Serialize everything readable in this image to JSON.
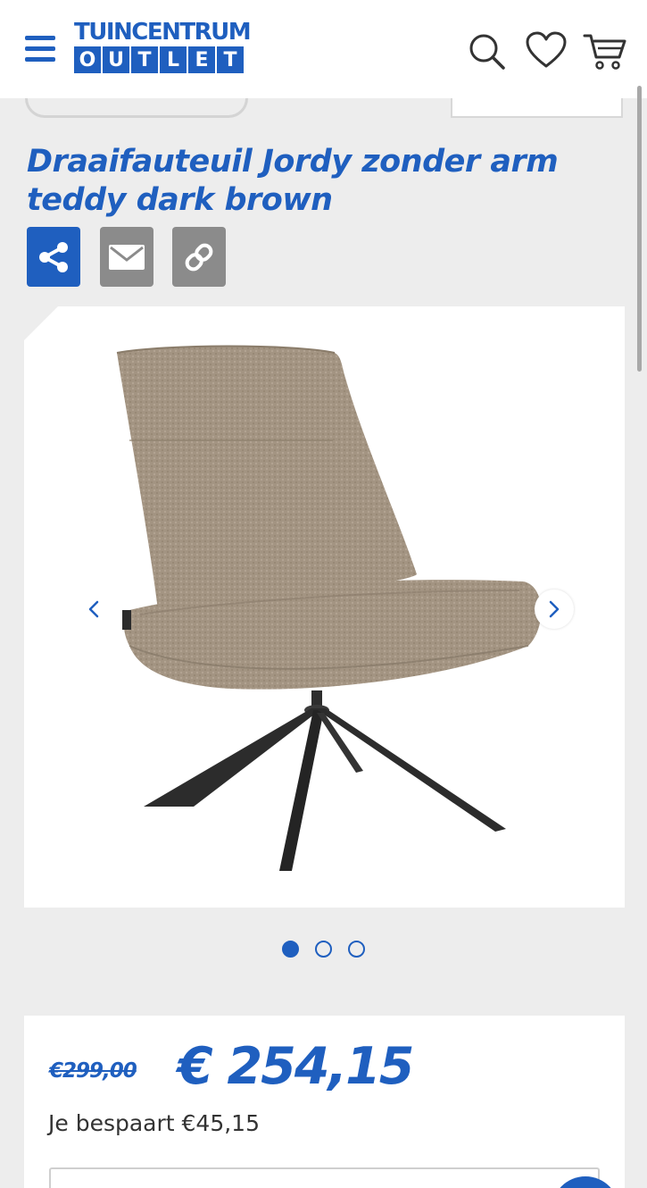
{
  "header": {
    "menu_icon": "hamburger-menu-icon",
    "logo_top": "TUINCENTRUM",
    "logo_bottom_letters": [
      "O",
      "U",
      "T",
      "L",
      "E",
      "T"
    ],
    "icons": [
      "search-icon",
      "heart-icon",
      "cart-icon"
    ],
    "brand_color": "#1f5fbf"
  },
  "product": {
    "title": "Draaifauteuil Jordy zonder arm teddy dark brown",
    "share_buttons": [
      {
        "icon": "share-icon",
        "color": "#1f5fbf"
      },
      {
        "icon": "mail-icon",
        "color": "#8b8b8b"
      },
      {
        "icon": "link-icon",
        "color": "#8b8b8b"
      }
    ]
  },
  "gallery": {
    "image": "swivel-chair-image",
    "prev_icon": "chevron-left-icon",
    "next_icon": "chevron-right-icon",
    "slide_count": 3,
    "active_slide": 1
  },
  "pricing": {
    "old_price": "€299,00",
    "new_price": "€ 254,15",
    "savings": "Je bespaart €45,15"
  }
}
